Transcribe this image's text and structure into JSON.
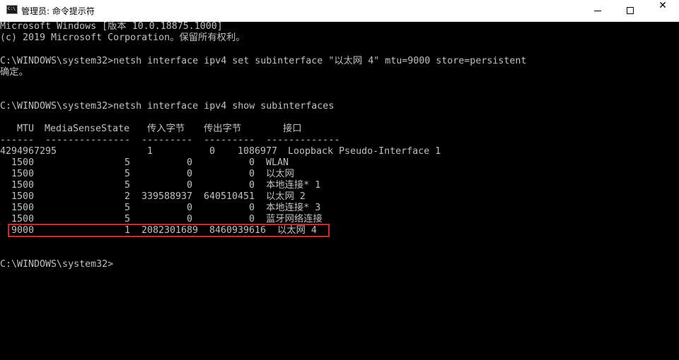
{
  "window": {
    "title": "管理员: 命令提示符",
    "minimize_glyph": "",
    "maximize_glyph": "",
    "close_glyph": "✕"
  },
  "console": {
    "banner_1": "Microsoft Windows [版本 10.0.18875.1000]",
    "banner_2": "(c) 2019 Microsoft Corporation。保留所有权利。",
    "cmd_1": "C:\\WINDOWS\\system32>netsh interface ipv4 set subinterface \"以太网 4\" mtu=9000 store=persistent",
    "result_1": "确定。",
    "cmd_2": "C:\\WINDOWS\\system32>netsh interface ipv4 show subinterfaces",
    "table": {
      "headers": [
        "MTU",
        "MediaSenseState",
        "传入字节",
        "传出字节",
        "接口"
      ],
      "separator": "------  ---------------  ---------  ---------  -------------",
      "rows": [
        {
          "mtu": "4294967295",
          "state": "1",
          "in": "0",
          "out": "1086977",
          "iface": "Loopback Pseudo-Interface 1"
        },
        {
          "mtu": "1500",
          "state": "5",
          "in": "0",
          "out": "0",
          "iface": "WLAN"
        },
        {
          "mtu": "1500",
          "state": "5",
          "in": "0",
          "out": "0",
          "iface": "以太网"
        },
        {
          "mtu": "1500",
          "state": "5",
          "in": "0",
          "out": "0",
          "iface": "本地连接* 1"
        },
        {
          "mtu": "1500",
          "state": "2",
          "in": "339588937",
          "out": "640510451",
          "iface": "以太网 2"
        },
        {
          "mtu": "1500",
          "state": "5",
          "in": "0",
          "out": "0",
          "iface": "本地连接* 3"
        },
        {
          "mtu": "1500",
          "state": "5",
          "in": "0",
          "out": "0",
          "iface": "蓝牙网络连接"
        },
        {
          "mtu": "9000",
          "state": "1",
          "in": "2082301689",
          "out": "8460939616",
          "iface": "以太网 4"
        }
      ]
    },
    "prompt": "C:\\WINDOWS\\system32>",
    "highlight_color": "#d9252a"
  }
}
